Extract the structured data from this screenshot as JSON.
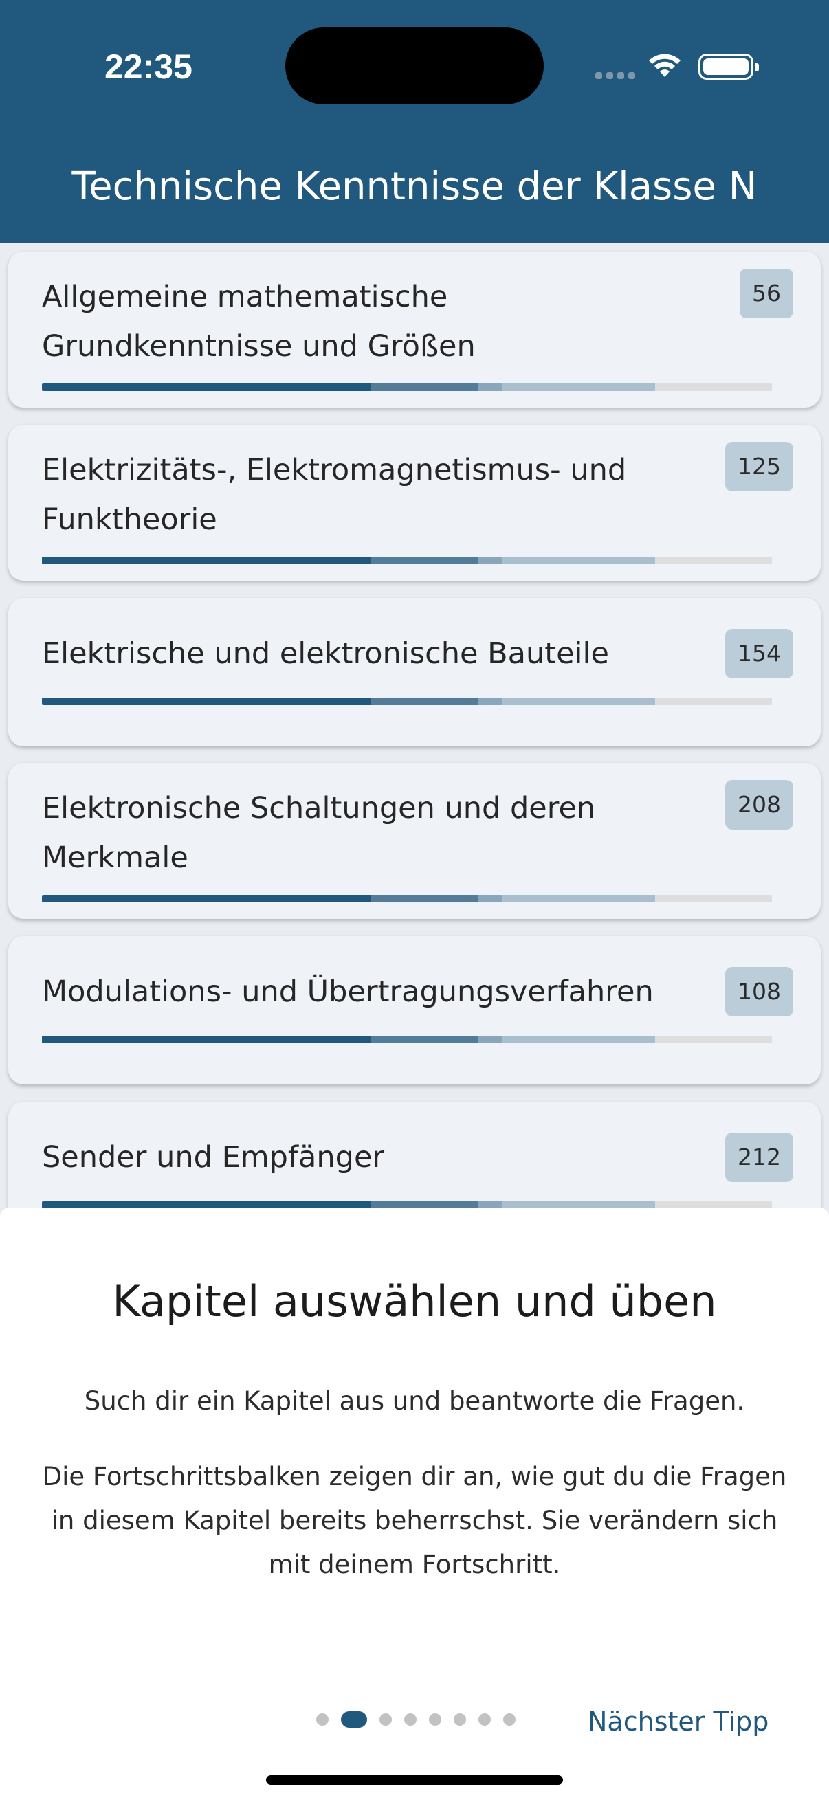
{
  "status_bar": {
    "time": "22:35"
  },
  "header": {
    "title": "Technische Kenntnisse der Klasse N"
  },
  "progress_segments": {
    "colors": [
      "#21597e",
      "#537c99",
      "#89a6ba",
      "#a9bfce",
      "#dedede"
    ],
    "fractions": [
      0.451,
      0.146,
      0.033,
      0.21,
      0.16
    ]
  },
  "chapters": [
    {
      "label": "Allgemeine mathematische Grundkenntnisse und Größen",
      "count": "56"
    },
    {
      "label": "Elektrizitäts-, Elektromagnetismus- und Funktheorie",
      "count": "125"
    },
    {
      "label": "Elektrische und elektronische Bauteile",
      "count": "154"
    },
    {
      "label": "Elektronische Schaltungen und deren Merkmale",
      "count": "208"
    },
    {
      "label": "Modulations- und Übertragungsverfahren",
      "count": "108"
    },
    {
      "label": "Sender und Empfänger",
      "count": "212"
    }
  ],
  "tip_sheet": {
    "title": "Kapitel auswählen und üben",
    "paragraph_1": "Such dir ein Kapitel aus und beantworte die Fragen.",
    "paragraph_2": "Die Fortschrittsbalken zeigen dir an, wie gut du die Fragen in diesem Kapitel bereits beherrschst. Sie verändern sich mit deinem Fortschritt.",
    "page_count": 8,
    "current_page": 2,
    "next_label": "Nächster Tipp"
  }
}
